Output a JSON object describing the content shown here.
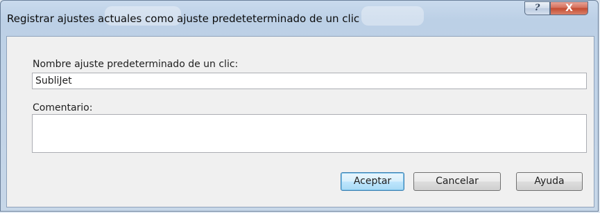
{
  "window": {
    "title": "Registrar ajustes actuales como ajuste predeteterminado de un clic",
    "help_glyph": "?",
    "close_glyph": "X"
  },
  "form": {
    "name_label": "Nombre ajuste predeterminado de un clic:",
    "name_value": "SubliJet",
    "comment_label": "Comentario:",
    "comment_value": ""
  },
  "buttons": {
    "accept": "Aceptar",
    "cancel": "Cancelar",
    "help": "Ayuda"
  },
  "colors": {
    "title_bar": "#c3d5ea",
    "client_bg": "#f0f0f0",
    "close_button": "#c44b31",
    "default_button_border": "#3c7fb1"
  }
}
